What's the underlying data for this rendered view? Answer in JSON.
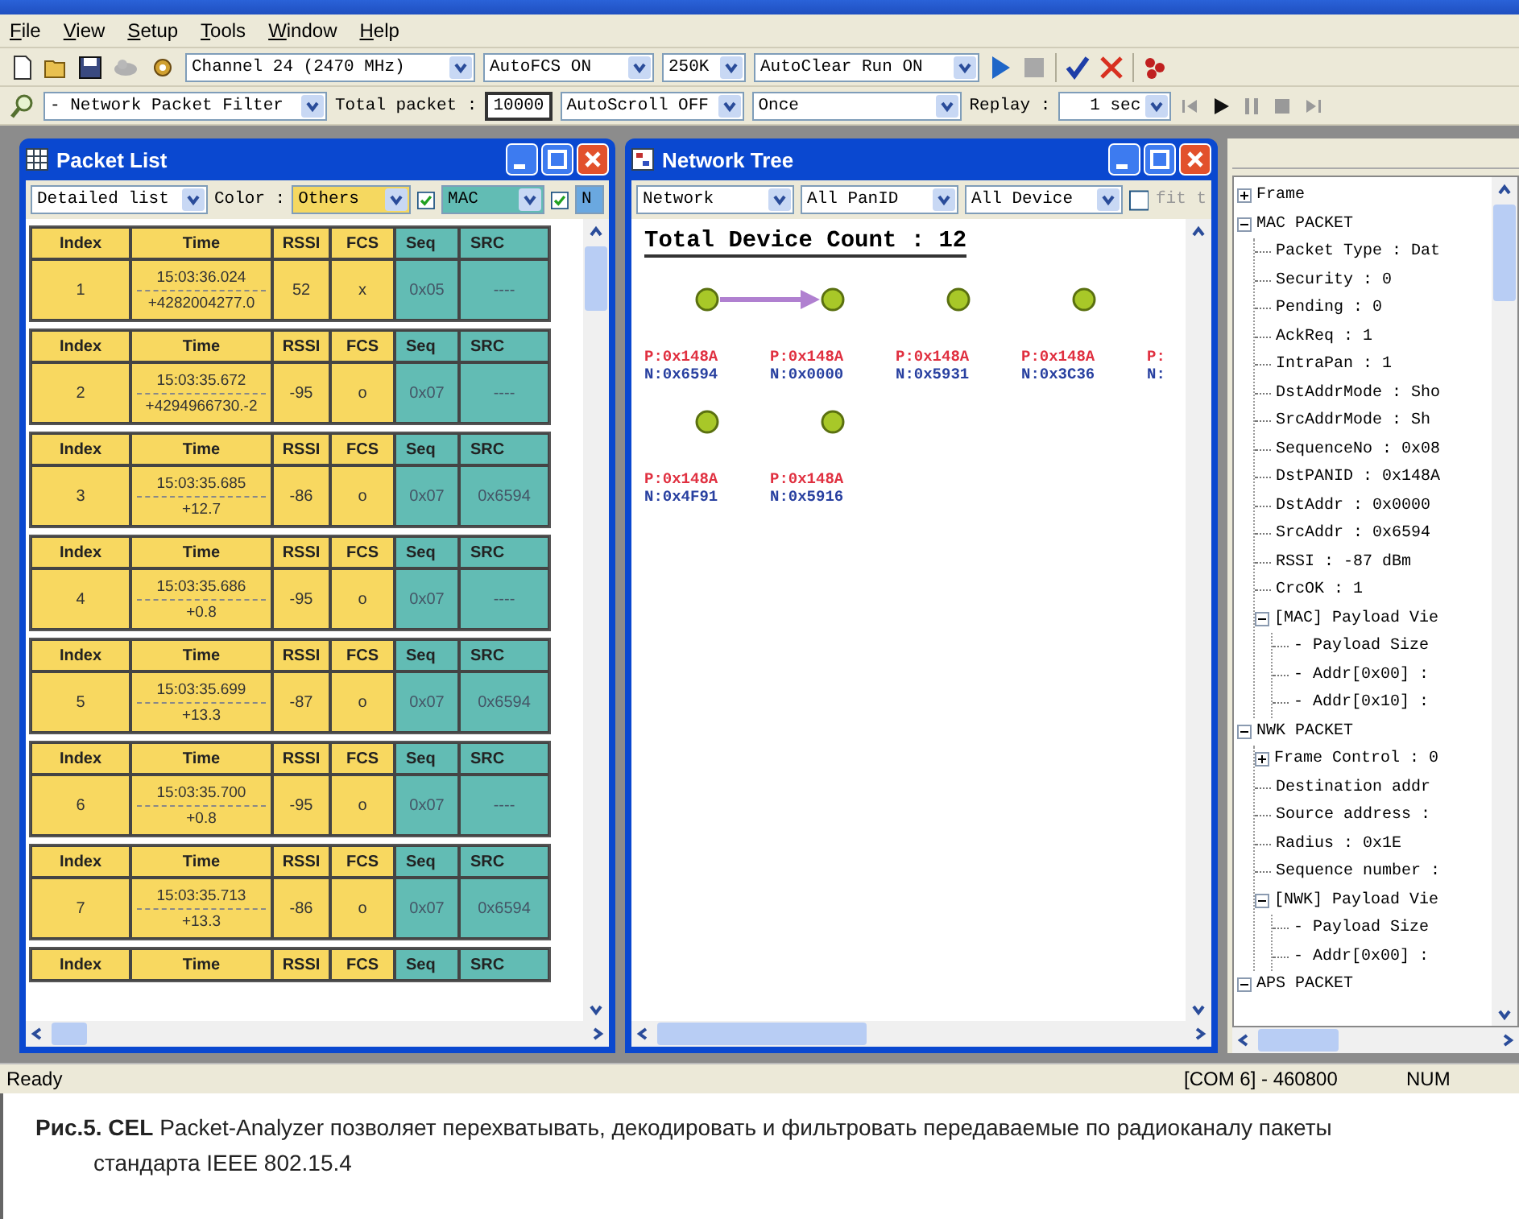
{
  "menu": [
    "File",
    "View",
    "Setup",
    "Tools",
    "Window",
    "Help"
  ],
  "toolbar": {
    "channel": "Channel 24 (2470 MHz)",
    "fcs": "AutoFCS ON",
    "rate": "250K",
    "autoclear": "AutoClear Run ON"
  },
  "filter_bar": {
    "filter": "- Network Packet Filter",
    "total_label": "Total packet :",
    "total_value": "10000",
    "autoscroll": "AutoScroll OFF",
    "mode": "Once",
    "replay_label": "Replay :",
    "replay_interval": "1 sec"
  },
  "packet_list": {
    "title": "Packet List",
    "view": "Detailed list",
    "color_label": "Color :",
    "color_filters": [
      {
        "label": "Others",
        "color": "#f5d860",
        "checked": true
      },
      {
        "label": "MAC",
        "color": "#62bcb4",
        "checked": true
      },
      {
        "label": "N",
        "color": "#6aa8e0"
      }
    ],
    "packets": [
      {
        "headers": [
          "Index",
          "Time",
          "RSSI",
          "FCS",
          "Seq",
          "SRC"
        ],
        "index": "1",
        "time": "15:03:36.024",
        "delta": "+4282004277.0",
        "rssi": "52",
        "fcs": "x",
        "seq": "0x05",
        "src": "----"
      },
      {
        "headers": [
          "Index",
          "Time",
          "RSSI",
          "FCS",
          "Seq",
          "SRC"
        ],
        "index": "2",
        "time": "15:03:35.672",
        "delta": "+4294966730.-2",
        "rssi": "-95",
        "fcs": "o",
        "seq": "0x07",
        "src": "----"
      },
      {
        "headers": [
          "Index",
          "Time",
          "RSSI",
          "FCS",
          "Seq",
          "SRC"
        ],
        "index": "3",
        "time": "15:03:35.685",
        "delta": "+12.7",
        "rssi": "-86",
        "fcs": "o",
        "seq": "0x07",
        "src": "0x6594"
      },
      {
        "headers": [
          "Index",
          "Time",
          "RSSI",
          "FCS",
          "Seq",
          "SRC"
        ],
        "index": "4",
        "time": "15:03:35.686",
        "delta": "+0.8",
        "rssi": "-95",
        "fcs": "o",
        "seq": "0x07",
        "src": "----"
      },
      {
        "headers": [
          "Index",
          "Time",
          "RSSI",
          "FCS",
          "Seq",
          "SRC"
        ],
        "index": "5",
        "time": "15:03:35.699",
        "delta": "+13.3",
        "rssi": "-87",
        "fcs": "o",
        "seq": "0x07",
        "src": "0x6594"
      },
      {
        "headers": [
          "Index",
          "Time",
          "RSSI",
          "FCS",
          "Seq",
          "SRC"
        ],
        "index": "6",
        "time": "15:03:35.700",
        "delta": "+0.8",
        "rssi": "-95",
        "fcs": "o",
        "seq": "0x07",
        "src": "----"
      },
      {
        "headers": [
          "Index",
          "Time",
          "RSSI",
          "FCS",
          "Seq",
          "SRC"
        ],
        "index": "7",
        "time": "15:03:35.713",
        "delta": "+13.3",
        "rssi": "-86",
        "fcs": "o",
        "seq": "0x07",
        "src": "0x6594"
      },
      {
        "headers": [
          "Index",
          "Time",
          "RSSI",
          "FCS",
          "Seq",
          "SRC"
        ]
      }
    ]
  },
  "network_tree": {
    "title": "Network Tree",
    "view": "Network",
    "panid": "All PanID",
    "device": "All Device",
    "fit": {
      "label": "fit t",
      "checked": false
    },
    "count": "Total Device Count : 12",
    "node_rows": [
      [
        {
          "pan": "P:0x148A",
          "addr": "N:0x6594"
        },
        {
          "pan": "P:0x148A",
          "addr": "N:0x0000",
          "link_from_prev": true
        },
        {
          "pan": "P:0x148A",
          "addr": "N:0x5931"
        },
        {
          "pan": "P:0x148A",
          "addr": "N:0x3C36"
        },
        {
          "pan": "P:",
          "addr": "N:",
          "cut": true
        }
      ],
      [
        {
          "pan": "P:0x148A",
          "addr": "N:0x4F91"
        },
        {
          "pan": "P:0x148A",
          "addr": "N:0x5916"
        }
      ]
    ]
  },
  "decode_tree": [
    {
      "label": "Frame",
      "expanded": false
    },
    {
      "label": "MAC PACKET",
      "expanded": true,
      "children": [
        {
          "label": "Packet Type : Dat"
        },
        {
          "label": "Security : 0"
        },
        {
          "label": "Pending : 0"
        },
        {
          "label": "AckReq : 1"
        },
        {
          "label": "IntraPan : 1"
        },
        {
          "label": "DstAddrMode : Sho"
        },
        {
          "label": "SrcAddrMode  : Sh"
        },
        {
          "label": "SequenceNo : 0x08"
        },
        {
          "label": "DstPANID : 0x148A"
        },
        {
          "label": "DstAddr : 0x0000"
        },
        {
          "label": "SrcAddr : 0x6594"
        },
        {
          "label": "RSSI : -87 dBm"
        },
        {
          "label": "CrcOK : 1"
        },
        {
          "label": "[MAC] Payload Vie",
          "expanded": true,
          "children": [
            {
              "label": "- Payload Size"
            },
            {
              "label": "- Addr[0x00] :"
            },
            {
              "label": "- Addr[0x10] :"
            }
          ]
        }
      ]
    },
    {
      "label": "NWK PACKET",
      "expanded": true,
      "children": [
        {
          "label": "Frame Control : 0",
          "expanded": false
        },
        {
          "label": "Destination addr"
        },
        {
          "label": "Source address :"
        },
        {
          "label": "Radius : 0x1E"
        },
        {
          "label": "Sequence number :"
        },
        {
          "label": "[NWK] Payload Vie",
          "expanded": true,
          "children": [
            {
              "label": "- Payload Size"
            },
            {
              "label": "- Addr[0x00] :"
            }
          ]
        }
      ]
    },
    {
      "label": "APS PACKET",
      "expanded": true
    }
  ],
  "status_bar": {
    "message": "Ready",
    "port": "[COM 6] - 460800",
    "num": "NUM"
  },
  "caption": "**Рис.5. CEL** Packet-Analyzer позволяет перехватывать, декодировать и фильтровать передаваемые по радиоканалу пакеты стандарта IEEE 802.15.4"
}
